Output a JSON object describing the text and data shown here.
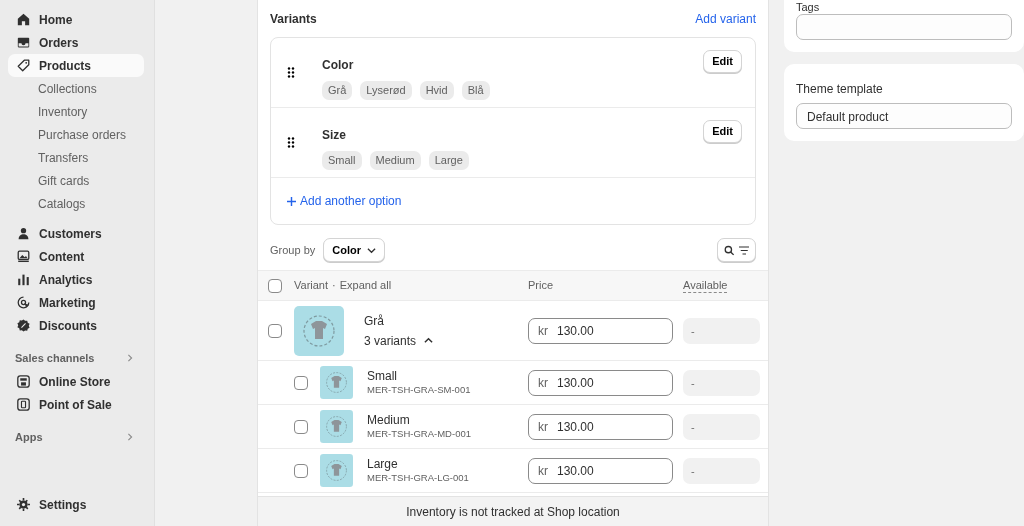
{
  "sidebar": {
    "items": [
      {
        "label": "Home",
        "selected": false
      },
      {
        "label": "Orders",
        "selected": false
      },
      {
        "label": "Products",
        "selected": true,
        "children": [
          {
            "label": "Collections"
          },
          {
            "label": "Inventory"
          },
          {
            "label": "Purchase orders"
          },
          {
            "label": "Transfers"
          },
          {
            "label": "Gift cards"
          },
          {
            "label": "Catalogs"
          }
        ]
      },
      {
        "label": "Customers",
        "selected": false
      },
      {
        "label": "Content",
        "selected": false
      },
      {
        "label": "Analytics",
        "selected": false
      },
      {
        "label": "Marketing",
        "selected": false
      },
      {
        "label": "Discounts",
        "selected": false
      }
    ],
    "sections": [
      {
        "title": "Sales channels",
        "items": [
          {
            "label": "Online Store"
          },
          {
            "label": "Point of Sale"
          }
        ]
      },
      {
        "title": "Apps"
      }
    ],
    "settings": {
      "label": "Settings"
    }
  },
  "variants": {
    "title": "Variants",
    "add_link": "Add variant",
    "options": [
      {
        "name": "Color",
        "edit": "Edit",
        "values": [
          "Grå",
          "Lyserød",
          "Hvid",
          "Blå"
        ]
      },
      {
        "name": "Size",
        "edit": "Edit",
        "values": [
          "Small",
          "Medium",
          "Large"
        ]
      }
    ],
    "add_option": "Add another option",
    "group_by": {
      "label": "Group by",
      "value": "Color"
    },
    "table": {
      "select_all": {
        "checked": false
      },
      "columns": {
        "variant": "Variant",
        "separator": "·",
        "expand": "Expand all",
        "price": "Price",
        "available": "Available"
      },
      "rows": [
        {
          "name": "Grå",
          "count": "3 variants",
          "expanded": true,
          "checked": false,
          "currency": "kr",
          "price": "130.00",
          "available": "-",
          "children": [
            {
              "name": "Small",
              "sku": "MER-TSH-GRA-SM-001",
              "checked": false,
              "currency": "kr",
              "price": "130.00",
              "available": "-"
            },
            {
              "name": "Medium",
              "sku": "MER-TSH-GRA-MD-001",
              "checked": false,
              "currency": "kr",
              "price": "130.00",
              "available": "-"
            },
            {
              "name": "Large",
              "sku": "MER-TSH-GRA-LG-001",
              "checked": false,
              "currency": "kr",
              "price": "130.00",
              "available": "-"
            }
          ]
        }
      ]
    },
    "footer": "Inventory is not tracked at Shop location"
  },
  "side_panel": {
    "tags": {
      "label": "Tags"
    },
    "theme_template": {
      "label": "Theme template",
      "value": "Default product"
    }
  }
}
